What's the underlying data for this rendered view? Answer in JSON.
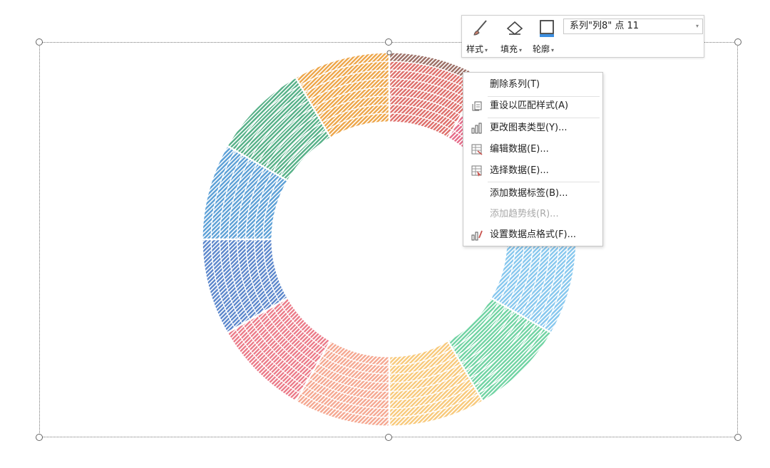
{
  "toolbar": {
    "style_label": "样式",
    "fill_label": "填充",
    "outline_label": "轮廓",
    "series_select_value": "系列\"列8\" 点 11",
    "style_icon": "brush-icon",
    "fill_icon": "paint-bucket-icon",
    "outline_icon": "shape-outline-icon"
  },
  "context_menu": {
    "items": [
      {
        "label": "删除系列(T)",
        "icon": "",
        "disabled": false
      },
      {
        "label": "重设以匹配样式(A)",
        "icon": "reset-style-icon",
        "disabled": false
      },
      {
        "label": "更改图表类型(Y)...",
        "icon": "bar-chart-icon",
        "disabled": false
      },
      {
        "label": "编辑数据(E)...",
        "icon": "edit-data-icon",
        "disabled": false
      },
      {
        "label": "选择数据(E)...",
        "icon": "select-data-icon",
        "disabled": false
      },
      {
        "label": "添加数据标签(B)...",
        "icon": "",
        "disabled": false
      },
      {
        "label": "添加趋势线(R)...",
        "icon": "",
        "disabled": true
      },
      {
        "label": "设置数据点格式(F)...",
        "icon": "format-point-icon",
        "disabled": false
      }
    ]
  },
  "chart_data": {
    "type": "doughnut",
    "rings": 8,
    "points_per_ring": 12,
    "values": [
      1,
      1,
      1,
      1,
      1,
      1,
      1,
      1,
      1,
      1,
      1,
      1
    ],
    "selected_series": "列8",
    "selected_point": 11,
    "point_colors": [
      "#de6e6a",
      "#e56a88",
      "#ef9a9a",
      "#86c7ee",
      "#6fd3a2",
      "#f8c97a",
      "#f5a790",
      "#eb7a88",
      "#5b86cb",
      "#5b9fd6",
      "#55b087",
      "#eda548"
    ],
    "selected_color": "#9b6d64",
    "fill_pattern": "diagonal-hatch"
  }
}
